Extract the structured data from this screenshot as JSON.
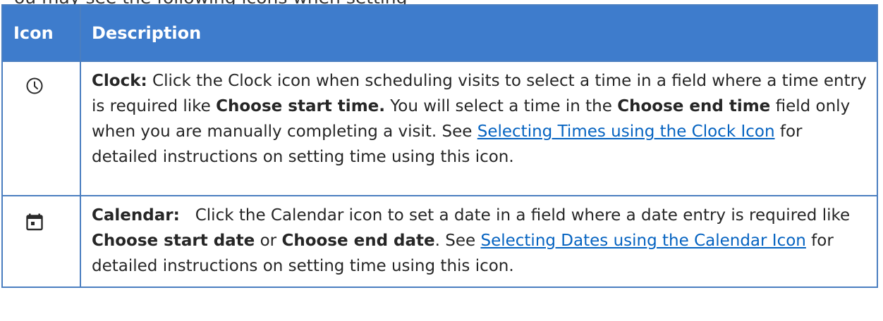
{
  "top_line": "ou may see the following icons when setting",
  "table": {
    "headers": {
      "icon": "Icon",
      "description": "Description"
    },
    "rows": [
      {
        "icon": "clock-icon",
        "label": "Clock:",
        "text_1": " Click the Clock icon when scheduling visits to select a time in a field where a time entry is required like ",
        "bold_1": "Choose start time.",
        "text_2": " You will select a time in the ",
        "bold_2": "Choose end time",
        "text_3": " field only when you are manually completing a visit. See ",
        "link": "Selecting Times using the Clock Icon",
        "text_4": " for detailed instructions on setting time using this icon."
      },
      {
        "icon": "calendar-icon",
        "label": "Calendar:",
        "text_1": "   Click the Calendar icon to set a date in a field where a date entry is required like ",
        "bold_1": "Choose start date",
        "text_2": " or ",
        "bold_2": "Choose end date",
        "text_3": ". See ",
        "link": "Selecting Dates using the Calendar Icon",
        "text_4": " for detailed instructions on setting time using this icon."
      }
    ]
  },
  "colors": {
    "header_bg": "#3e7ccc",
    "border": "#4a7ec0",
    "link": "#0563c1"
  }
}
